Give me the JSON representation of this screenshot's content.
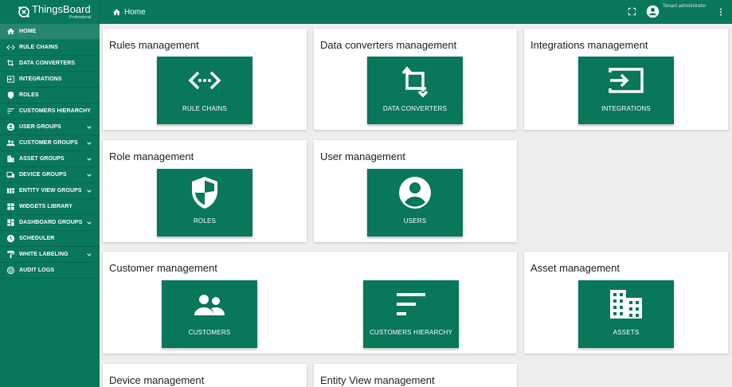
{
  "header": {
    "logo_name": "ThingsBoard",
    "logo_sub": "Professional",
    "breadcrumb": "Home",
    "user_name": "Tenant administrator"
  },
  "sidebar": {
    "items": [
      {
        "label": "HOME",
        "icon": "home-icon",
        "active": true
      },
      {
        "label": "RULE CHAINS",
        "icon": "code-arrows-icon"
      },
      {
        "label": "DATA CONVERTERS",
        "icon": "transform-icon"
      },
      {
        "label": "INTEGRATIONS",
        "icon": "input-icon"
      },
      {
        "label": "ROLES",
        "icon": "shield-icon"
      },
      {
        "label": "CUSTOMERS HIERARCHY",
        "icon": "sort-lines-icon"
      },
      {
        "label": "USER GROUPS",
        "icon": "account-circle-icon",
        "expandable": true
      },
      {
        "label": "CUSTOMER GROUPS",
        "icon": "people-icon",
        "expandable": true
      },
      {
        "label": "ASSET GROUPS",
        "icon": "domain-icon",
        "expandable": true
      },
      {
        "label": "DEVICE GROUPS",
        "icon": "devices-icon",
        "expandable": true
      },
      {
        "label": "ENTITY VIEW GROUPS",
        "icon": "view-quilt-icon",
        "expandable": true
      },
      {
        "label": "WIDGETS LIBRARY",
        "icon": "dashboard-grid-icon"
      },
      {
        "label": "DASHBOARD GROUPS",
        "icon": "dashboard-icon",
        "expandable": true
      },
      {
        "label": "SCHEDULER",
        "icon": "clock-icon"
      },
      {
        "label": "WHITE LABELING",
        "icon": "paint-roller-icon",
        "expandable": true
      },
      {
        "label": "AUDIT LOGS",
        "icon": "audit-track-icon"
      }
    ]
  },
  "cards": {
    "rules": {
      "title": "Rules management",
      "tiles": [
        "RULE CHAINS"
      ]
    },
    "converters": {
      "title": "Data converters management",
      "tiles": [
        "DATA CONVERTERS"
      ]
    },
    "integrations": {
      "title": "Integrations management",
      "tiles": [
        "INTEGRATIONS"
      ]
    },
    "roles": {
      "title": "Role management",
      "tiles": [
        "ROLES"
      ]
    },
    "users": {
      "title": "User management",
      "tiles": [
        "USERS"
      ]
    },
    "customers": {
      "title": "Customer management",
      "tiles": [
        "CUSTOMERS",
        "CUSTOMERS HIERARCHY"
      ]
    },
    "assets": {
      "title": "Asset management",
      "tiles": [
        "ASSETS"
      ]
    },
    "devices": {
      "title": "Device management"
    },
    "entity_views": {
      "title": "Entity View management"
    }
  },
  "colors": {
    "primary": "#08775a",
    "background": "#eeeeee",
    "card": "#ffffff"
  }
}
